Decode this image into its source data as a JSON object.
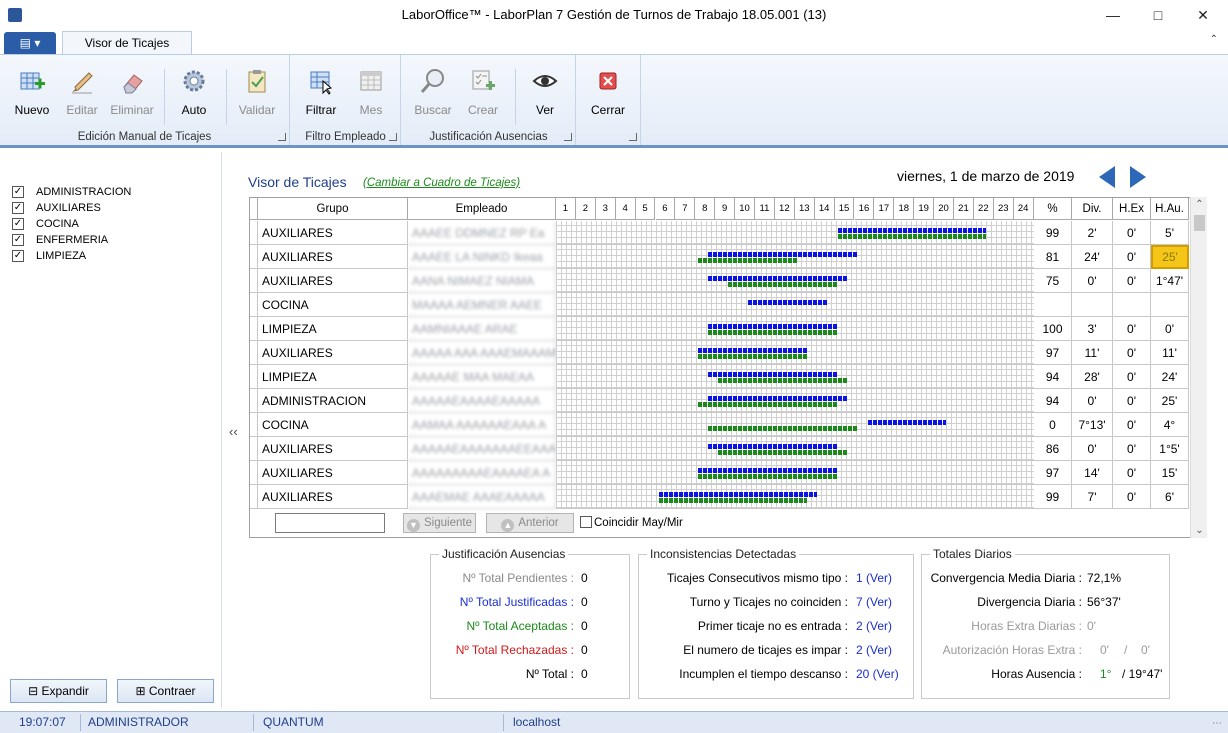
{
  "window": {
    "title": "LaborOffice™ - LaborPlan 7 Gestión de Turnos de Trabajo 18.05.001 (13)"
  },
  "ribbon": {
    "tab": "Visor de Ticajes",
    "groups": {
      "edicion": {
        "label": "Edición Manual de Ticajes",
        "nuevo": "Nuevo",
        "editar": "Editar",
        "eliminar": "Eliminar",
        "auto": "Auto",
        "validar": "Validar"
      },
      "filtro": {
        "label": "Filtro Empleado",
        "filtrar": "Filtrar",
        "mes": "Mes"
      },
      "justificacion": {
        "label": "Justificación Ausencias",
        "buscar": "Buscar",
        "crear": "Crear",
        "ver": "Ver"
      },
      "cerrar": {
        "cerrar": "Cerrar"
      }
    }
  },
  "filters": [
    "ADMINISTRACION",
    "AUXILIARES",
    "COCINA",
    "ENFERMERIA",
    "LIMPIEZA"
  ],
  "left_buttons": {
    "expandir": "Expandir",
    "contraer": "Contraer"
  },
  "viewer": {
    "heading": "Visor de Ticajes",
    "switch_link": "(Cambiar a Cuadro de Ticajes)",
    "date": "viernes, 1 de marzo de 2019"
  },
  "grid": {
    "headers": {
      "grupo": "Grupo",
      "empleado": "Empleado",
      "pct": "%",
      "div": "Div.",
      "hex": "H.Ex",
      "hau": "H.Au."
    },
    "hours": [
      "1",
      "2",
      "3",
      "4",
      "5",
      "6",
      "7",
      "8",
      "9",
      "10",
      "11",
      "12",
      "13",
      "14",
      "15",
      "16",
      "17",
      "18",
      "19",
      "20",
      "21",
      "22",
      "23",
      "24"
    ],
    "rows": [
      {
        "grupo": "AUXILIARES",
        "empleado": "AAAEE DDMNEZ RP Ea",
        "pct": "99",
        "div": "2'",
        "hex": "0'",
        "hau": "5'",
        "plan": [
          15.0,
          22.5
        ],
        "real": [
          15.0,
          22.5
        ],
        "real_shift": 0.0
      },
      {
        "grupo": "AUXILIARES",
        "empleado": "AAAEE LA NINKD Ikeaa",
        "pct": "81",
        "div": "24'",
        "hex": "0'",
        "hau": "25'",
        "plan": [
          8.5,
          16.0
        ],
        "real": [
          8.0,
          13.0
        ],
        "hau_highlight": true
      },
      {
        "grupo": "AUXILIARES",
        "empleado": "AANA NIMAEZ NIAMA",
        "pct": "75",
        "div": "0'",
        "hex": "0'",
        "hau": "1°47'",
        "plan": [
          8.5,
          15.5
        ],
        "real": [
          9.5,
          15.0
        ]
      },
      {
        "grupo": "COCINA",
        "empleado": "MAAAA AEMNER AAEE",
        "pct": "",
        "div": "",
        "hex": "",
        "hau": "",
        "plan": [
          10.5,
          14.5
        ],
        "real": null
      },
      {
        "grupo": "LIMPIEZA",
        "empleado": "AAMNIAAAE ARAE",
        "pct": "100",
        "div": "3'",
        "hex": "0'",
        "hau": "0'",
        "plan": [
          8.5,
          15.0
        ],
        "real": [
          8.5,
          15.0
        ]
      },
      {
        "grupo": "AUXILIARES",
        "empleado": "AAAAA AAA AAAEMAAAMAE",
        "pct": "97",
        "div": "11'",
        "hex": "0'",
        "hau": "11'",
        "plan": [
          8.0,
          13.5
        ],
        "real": [
          8.0,
          13.5
        ]
      },
      {
        "grupo": "LIMPIEZA",
        "empleado": "AAAAAE MAA MAEAA",
        "pct": "94",
        "div": "28'",
        "hex": "0'",
        "hau": "24'",
        "plan": [
          8.5,
          15.0
        ],
        "real": [
          9.0,
          15.5
        ]
      },
      {
        "grupo": "ADMINISTRACION",
        "empleado": "AAAAAEAAAAEAAAAA",
        "pct": "94",
        "div": "0'",
        "hex": "0'",
        "hau": "25'",
        "plan": [
          8.5,
          15.5
        ],
        "real": [
          8.0,
          15.0
        ]
      },
      {
        "grupo": "COCINA",
        "empleado": "AAMAA AAAAAAEAAA A",
        "pct": "0",
        "div": "7°13'",
        "hex": "0'",
        "hau": "4°",
        "plan": [
          16.5,
          20.5
        ],
        "real": [
          8.5,
          16.0
        ]
      },
      {
        "grupo": "AUXILIARES",
        "empleado": "AAAAAEAAAAAAAEEAAA",
        "pct": "86",
        "div": "0'",
        "hex": "0'",
        "hau": "1°5'",
        "plan": [
          8.5,
          15.0
        ],
        "real": [
          9.0,
          15.5
        ]
      },
      {
        "grupo": "AUXILIARES",
        "empleado": "AAAAAAAAAEAAAAEA A",
        "pct": "97",
        "div": "14'",
        "hex": "0'",
        "hau": "15'",
        "plan": [
          8.0,
          15.0
        ],
        "real": [
          8.0,
          15.0
        ]
      },
      {
        "grupo": "AUXILIARES",
        "empleado": "AAAEMAE AAAEAAAAA",
        "pct": "99",
        "div": "7'",
        "hex": "0'",
        "hau": "6'",
        "plan": [
          6.0,
          14.0
        ],
        "real": [
          6.0,
          13.5
        ]
      }
    ]
  },
  "find": {
    "siguiente": "Siguiente",
    "anterior": "Anterior",
    "coincidir": "Coincidir May/Mir"
  },
  "justificacion_panel": {
    "title": "Justificación Ausencias",
    "rows": [
      {
        "label": "Nº Total Pendientes :",
        "value": "0",
        "color": "#8a8a8a"
      },
      {
        "label": "Nº Total Justificadas :",
        "value": "0",
        "color": "#1a2fd0"
      },
      {
        "label": "Nº Total Aceptadas :",
        "value": "0",
        "color": "#1b8a1b"
      },
      {
        "label": "Nº Total Rechazadas :",
        "value": "0",
        "color": "#d01a1a"
      },
      {
        "label": "Nº Total :",
        "value": "0",
        "color": "#000000"
      }
    ]
  },
  "inconsistencias_panel": {
    "title": "Inconsistencias Detectadas",
    "rows": [
      {
        "label": "Ticajes Consecutivos mismo tipo :",
        "value": "1 (Ver)"
      },
      {
        "label": "Turno y Ticajes no coinciden :",
        "value": "7 (Ver)"
      },
      {
        "label": "Primer ticaje no es entrada :",
        "value": "2 (Ver)"
      },
      {
        "label": "El numero de ticajes es impar :",
        "value": "2 (Ver)"
      },
      {
        "label": "Incumplen el tiempo descanso :",
        "value": "20 (Ver)"
      }
    ]
  },
  "totales_panel": {
    "title": "Totales Diarios",
    "convergencia": {
      "label": "Convergencia Media Diaria :",
      "value": "72,1%"
    },
    "divergencia": {
      "label": "Divergencia Diaria :",
      "value": "56°37'"
    },
    "horas_extra": {
      "label": "Horas Extra Diarias :",
      "value": "0'"
    },
    "autorizacion": {
      "label": "Autorización Horas Extra :",
      "value_a": "0'",
      "sep": "/",
      "value_b": "0'"
    },
    "horas_ausencia": {
      "label": "Horas Ausencia :",
      "value_a": "1°",
      "value_b": "/ 19°47'"
    }
  },
  "statusbar": {
    "time": "19:07:07",
    "user": "ADMINISTRADOR",
    "company": "QUANTUM",
    "server": "localhost"
  }
}
